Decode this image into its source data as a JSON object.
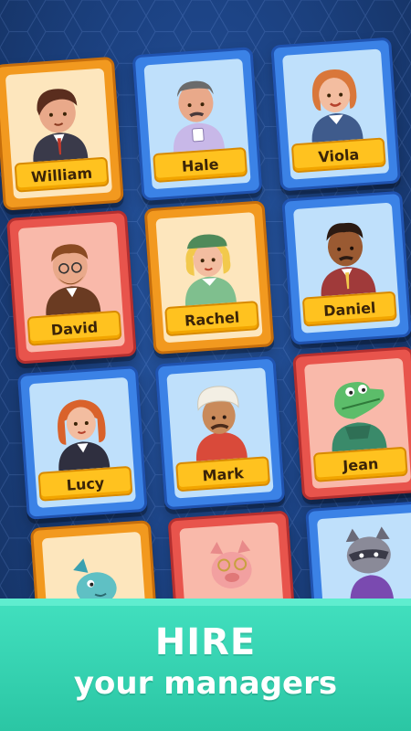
{
  "managers": [
    {
      "name": "William",
      "card_color": "orange"
    },
    {
      "name": "Hale",
      "card_color": "blue"
    },
    {
      "name": "Viola",
      "card_color": "blue"
    },
    {
      "name": "David",
      "card_color": "red"
    },
    {
      "name": "Rachel",
      "card_color": "orange"
    },
    {
      "name": "Daniel",
      "card_color": "blue"
    },
    {
      "name": "Lucy",
      "card_color": "blue"
    },
    {
      "name": "Mark",
      "card_color": "blue"
    },
    {
      "name": "Jean",
      "card_color": "red"
    },
    {
      "name": "",
      "card_color": "orange"
    },
    {
      "name": "",
      "card_color": "red"
    },
    {
      "name": "",
      "card_color": "blue"
    }
  ],
  "banner": {
    "title": "HIRE",
    "subtitle": "your managers"
  },
  "colors": {
    "background": "#1d4486",
    "banner": "#2bc6a4",
    "nameplate": "#ffc21f"
  }
}
